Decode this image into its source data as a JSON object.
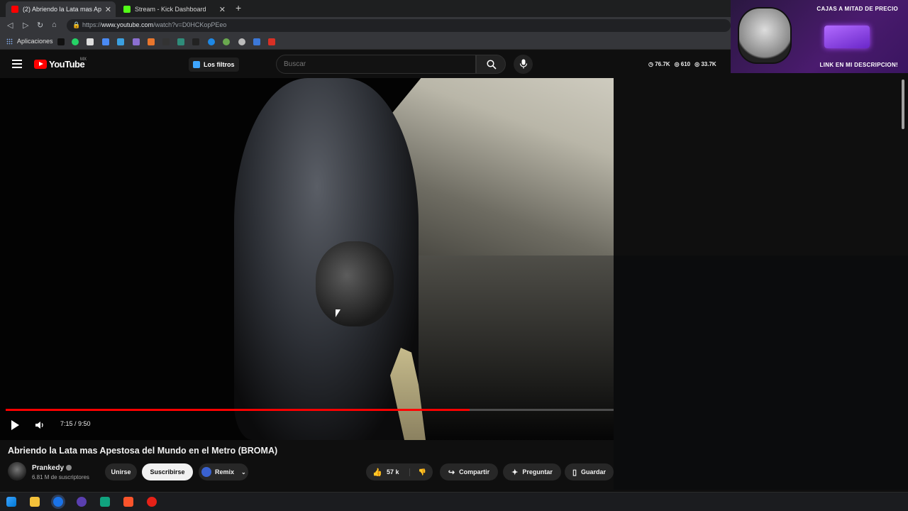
{
  "browser": {
    "tabs": [
      {
        "label": "(2) Abriendo la Lata mas Ap",
        "active": true
      },
      {
        "label": "Stream - Kick Dashboard",
        "active": false
      }
    ],
    "url_prefix": "https://",
    "url_domain": "www.youtube.com",
    "url_path": "/watch?v=D0HCKopPEeo",
    "bookmarks_label": "Aplicaciones"
  },
  "youtube": {
    "logo_text": "YouTube",
    "country_code": "MX",
    "filters_label": "Los filtros",
    "search_placeholder": "Buscar",
    "stats": [
      "76.7K",
      "610",
      "33.7K"
    ]
  },
  "promo": {
    "top_text": "CAJAS A MITAD DE PRECIO",
    "bottom_text": "LINK EN MI DESCRIPCION!"
  },
  "player": {
    "time": "7:15 / 9:50",
    "progress": 0.763
  },
  "video": {
    "title": "Abriendo la Lata mas Apestosa del Mundo en el Metro (BROMA)",
    "channel": "Prankedy",
    "subscribers": "6.81 M de suscriptores",
    "join_label": "Unirse",
    "subscribe_label": "Suscribirse",
    "remix_label": "Remix",
    "likes": "57 k",
    "share_label": "Compartir",
    "ask_label": "Preguntar",
    "save_label": "Guardar"
  },
  "colors": {
    "accent": "#ff0000",
    "background": "#0f0f0f"
  }
}
